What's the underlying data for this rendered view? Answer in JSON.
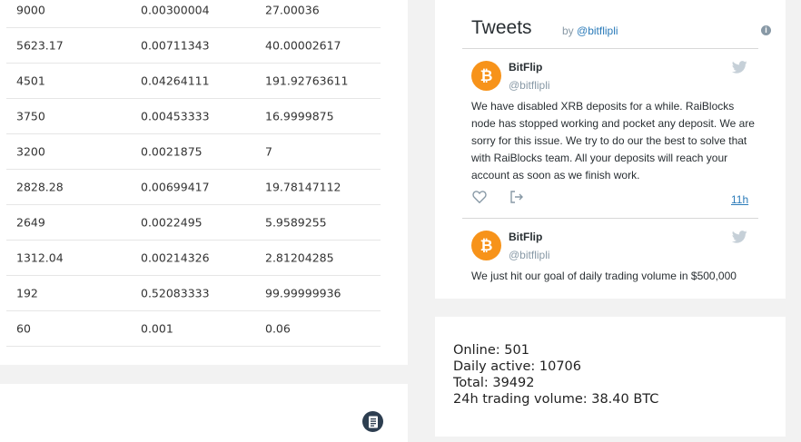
{
  "order_table": {
    "rows": [
      {
        "price": "9000",
        "amount": "0.00300004",
        "total": "27.00036"
      },
      {
        "price": "5623.17",
        "amount": "0.00711343",
        "total": "40.00002617"
      },
      {
        "price": "4501",
        "amount": "0.04264111",
        "total": "191.92763611"
      },
      {
        "price": "3750",
        "amount": "0.00453333",
        "total": "16.9999875"
      },
      {
        "price": "3200",
        "amount": "0.0021875",
        "total": "7"
      },
      {
        "price": "2828.28",
        "amount": "0.00699417",
        "total": "19.78147112"
      },
      {
        "price": "2649",
        "amount": "0.0022495",
        "total": "5.9589255"
      },
      {
        "price": "1312.04",
        "amount": "0.00214326",
        "total": "2.81204285"
      },
      {
        "price": "192",
        "amount": "0.52083333",
        "total": "99.99999936"
      },
      {
        "price": "60",
        "amount": "0.001",
        "total": "0.06"
      }
    ]
  },
  "tweets_widget": {
    "title": "Tweets",
    "by_prefix": "by",
    "by_handle": "@bitflipli",
    "tweets": [
      {
        "author_name": "BitFlip",
        "author_handle": "@bitflipli",
        "text": "We have disabled XRB deposits for a while. RaiBlocks node has stopped working and pocket any deposit. We are sorry for this issue. We try to do our the best to solve that with RaiBlocks team. All your deposits will reach your account as soon as we finish work.",
        "time": "11h"
      },
      {
        "author_name": "BitFlip",
        "author_handle": "@bitflipli",
        "text": "We just hit our goal of daily trading volume in $500,000"
      }
    ]
  },
  "stats": {
    "online": "Online: 501",
    "daily_active": "Daily active: 10706",
    "total": "Total: 39492",
    "volume": "24h trading volume: 38.40 BTC"
  },
  "colors": {
    "bitcoin_orange": "#f7931a",
    "twitter_blue": "#2b7bb9",
    "doc_icon_bg": "#2d3e50"
  },
  "icons": {
    "document": "document-icon",
    "info": "info-icon",
    "twitter": "twitter-bird-icon",
    "like": "heart-icon",
    "share": "share-icon",
    "avatar": "bitcoin-logo-icon"
  }
}
